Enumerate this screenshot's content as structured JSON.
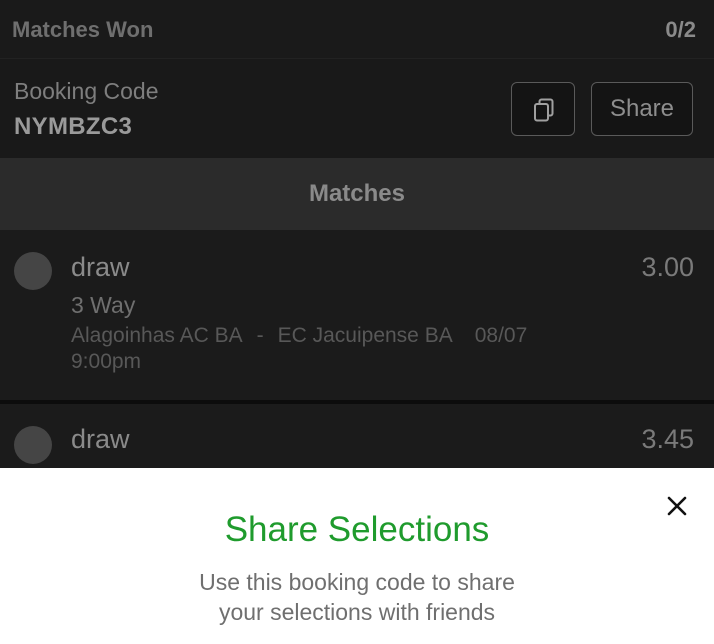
{
  "summary": {
    "matches_won_label": "Matches Won",
    "matches_won_value": "0/2"
  },
  "booking": {
    "label": "Booking Code",
    "code": "NYMBZC3",
    "copy_icon": "copy-icon",
    "share_label": "Share"
  },
  "matches_header": "Matches",
  "matches": [
    {
      "pick": "draw",
      "odds": "3.00",
      "market": "3 Way",
      "home": "Alagoinhas AC BA",
      "separator": "-",
      "away": "EC Jacuipense BA",
      "date": "08/07",
      "time": "9:00pm"
    },
    {
      "pick": "draw",
      "odds": "3.45"
    }
  ],
  "share_sheet": {
    "title": "Share Selections",
    "description_line1": "Use this booking code to share",
    "description_line2": "your selections with friends",
    "close_icon": "close-icon"
  },
  "colors": {
    "accent_green": "#1f9b2d",
    "background": "#151515",
    "sheet_background": "#ffffff"
  }
}
